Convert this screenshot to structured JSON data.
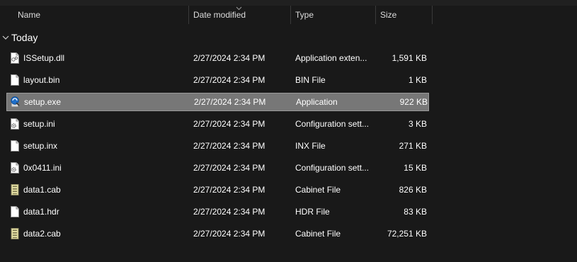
{
  "columns": {
    "name": "Name",
    "date": "Date modified",
    "type": "Type",
    "size": "Size"
  },
  "group": {
    "label": "Today"
  },
  "files": [
    {
      "name": "ISSetup.dll",
      "date": "2/27/2024 2:34 PM",
      "type": "Application exten...",
      "size": "1,591 KB",
      "icon": "dll-icon"
    },
    {
      "name": "layout.bin",
      "date": "2/27/2024 2:34 PM",
      "type": "BIN File",
      "size": "1 KB",
      "icon": "file-icon"
    },
    {
      "name": "setup.exe",
      "date": "2/27/2024 2:34 PM",
      "type": "Application",
      "size": "922 KB",
      "icon": "installer-icon",
      "selected": true
    },
    {
      "name": "setup.ini",
      "date": "2/27/2024 2:34 PM",
      "type": "Configuration sett...",
      "size": "3 KB",
      "icon": "config-file-icon"
    },
    {
      "name": "setup.inx",
      "date": "2/27/2024 2:34 PM",
      "type": "INX File",
      "size": "271 KB",
      "icon": "file-icon"
    },
    {
      "name": "0x0411.ini",
      "date": "2/27/2024 2:34 PM",
      "type": "Configuration sett...",
      "size": "15 KB",
      "icon": "config-file-icon"
    },
    {
      "name": "data1.cab",
      "date": "2/27/2024 2:34 PM",
      "type": "Cabinet File",
      "size": "826 KB",
      "icon": "cabinet-icon"
    },
    {
      "name": "data1.hdr",
      "date": "2/27/2024 2:34 PM",
      "type": "HDR File",
      "size": "83 KB",
      "icon": "file-icon"
    },
    {
      "name": "data2.cab",
      "date": "2/27/2024 2:34 PM",
      "type": "Cabinet File",
      "size": "72,251 KB",
      "icon": "cabinet-icon"
    }
  ],
  "colors": {
    "background": "#191919",
    "selection": "#777777",
    "text": "#ffffff"
  }
}
